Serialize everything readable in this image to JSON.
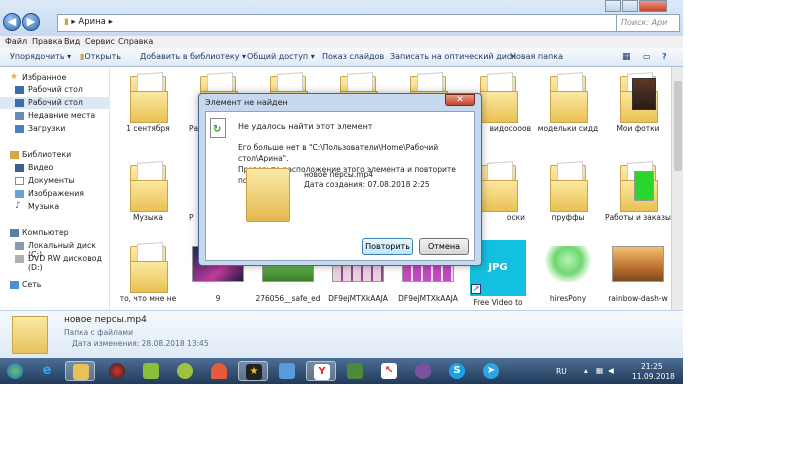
{
  "window": {
    "breadcrumb": "Арина",
    "search_placeholder": "Поиск: Ари",
    "back_icon": "arrow-left-icon",
    "forward_icon": "arrow-right-icon"
  },
  "menu": [
    "Файл",
    "Правка",
    "Вид",
    "Сервис",
    "Справка"
  ],
  "toolbar": {
    "organize": "Упорядочить ▾",
    "open": "Открыть",
    "add_to_library": "Добавить в библиотеку ▾",
    "share": "Общий доступ ▾",
    "slideshow": "Показ слайдов",
    "burn": "Записать на оптический диск",
    "new_folder": "Новая папка"
  },
  "nav": {
    "favorites": "Избранное",
    "desktop1": "Рабочий стол",
    "desktop2": "Рабочий стол",
    "recent": "Недавние места",
    "downloads": "Загрузки",
    "libraries": "Библиотеки",
    "video": "Видео",
    "documents": "Документы",
    "images": "Изображения",
    "music": "Музыка",
    "computer": "Компьютер",
    "local_disk": "Локальный диск (C:)",
    "dvd": "DVD RW дисковод (D:)",
    "network": "Сеть"
  },
  "items": {
    "r1c1": "1 сентября",
    "r1c2": "Ра",
    "r1c6": "видосооов",
    "r1c7": "модельки сидд",
    "r1c8": "Мои фотки",
    "r2c1": "Музыка",
    "r2c2": "Р",
    "r2c6": "оски",
    "r2c7": "пруффы",
    "r2c8": "Работы и заказы",
    "r3c1": "то, что мне не",
    "r3c2": "9",
    "r3c3": "276056__safe_ed",
    "r3c4": "DF9ejMTXkAAJA",
    "r3c5": "DF9ejMTXkAAJA",
    "r3c6": "Free Video to",
    "r3c7": "hiresPony",
    "r3c8": "rainbow-dash-w",
    "jpg_badge": "JPG"
  },
  "details": {
    "name": "новое персы.mp4",
    "type": "Папка с файлами",
    "modified": "Дата изменения: 28.08.2018 13:45"
  },
  "dialog": {
    "title": "Элемент не найден",
    "close": "✕",
    "message": "Не удалось найти этот элемент",
    "detail_line1": "Его больше нет в \"C:\\Пользователи\\Home\\Рабочий стол\\Арина\".",
    "detail_line2": "Проверьте расположение этого элемента и повторите попытку.",
    "file_name": "новое персы.mp4",
    "file_date": "Дата создания: 07.08.2018 2:25",
    "retry": "Повторить",
    "cancel": "Отмена"
  },
  "tray": {
    "lang": "RU",
    "time": "21:25",
    "date": "11.09.2018"
  }
}
